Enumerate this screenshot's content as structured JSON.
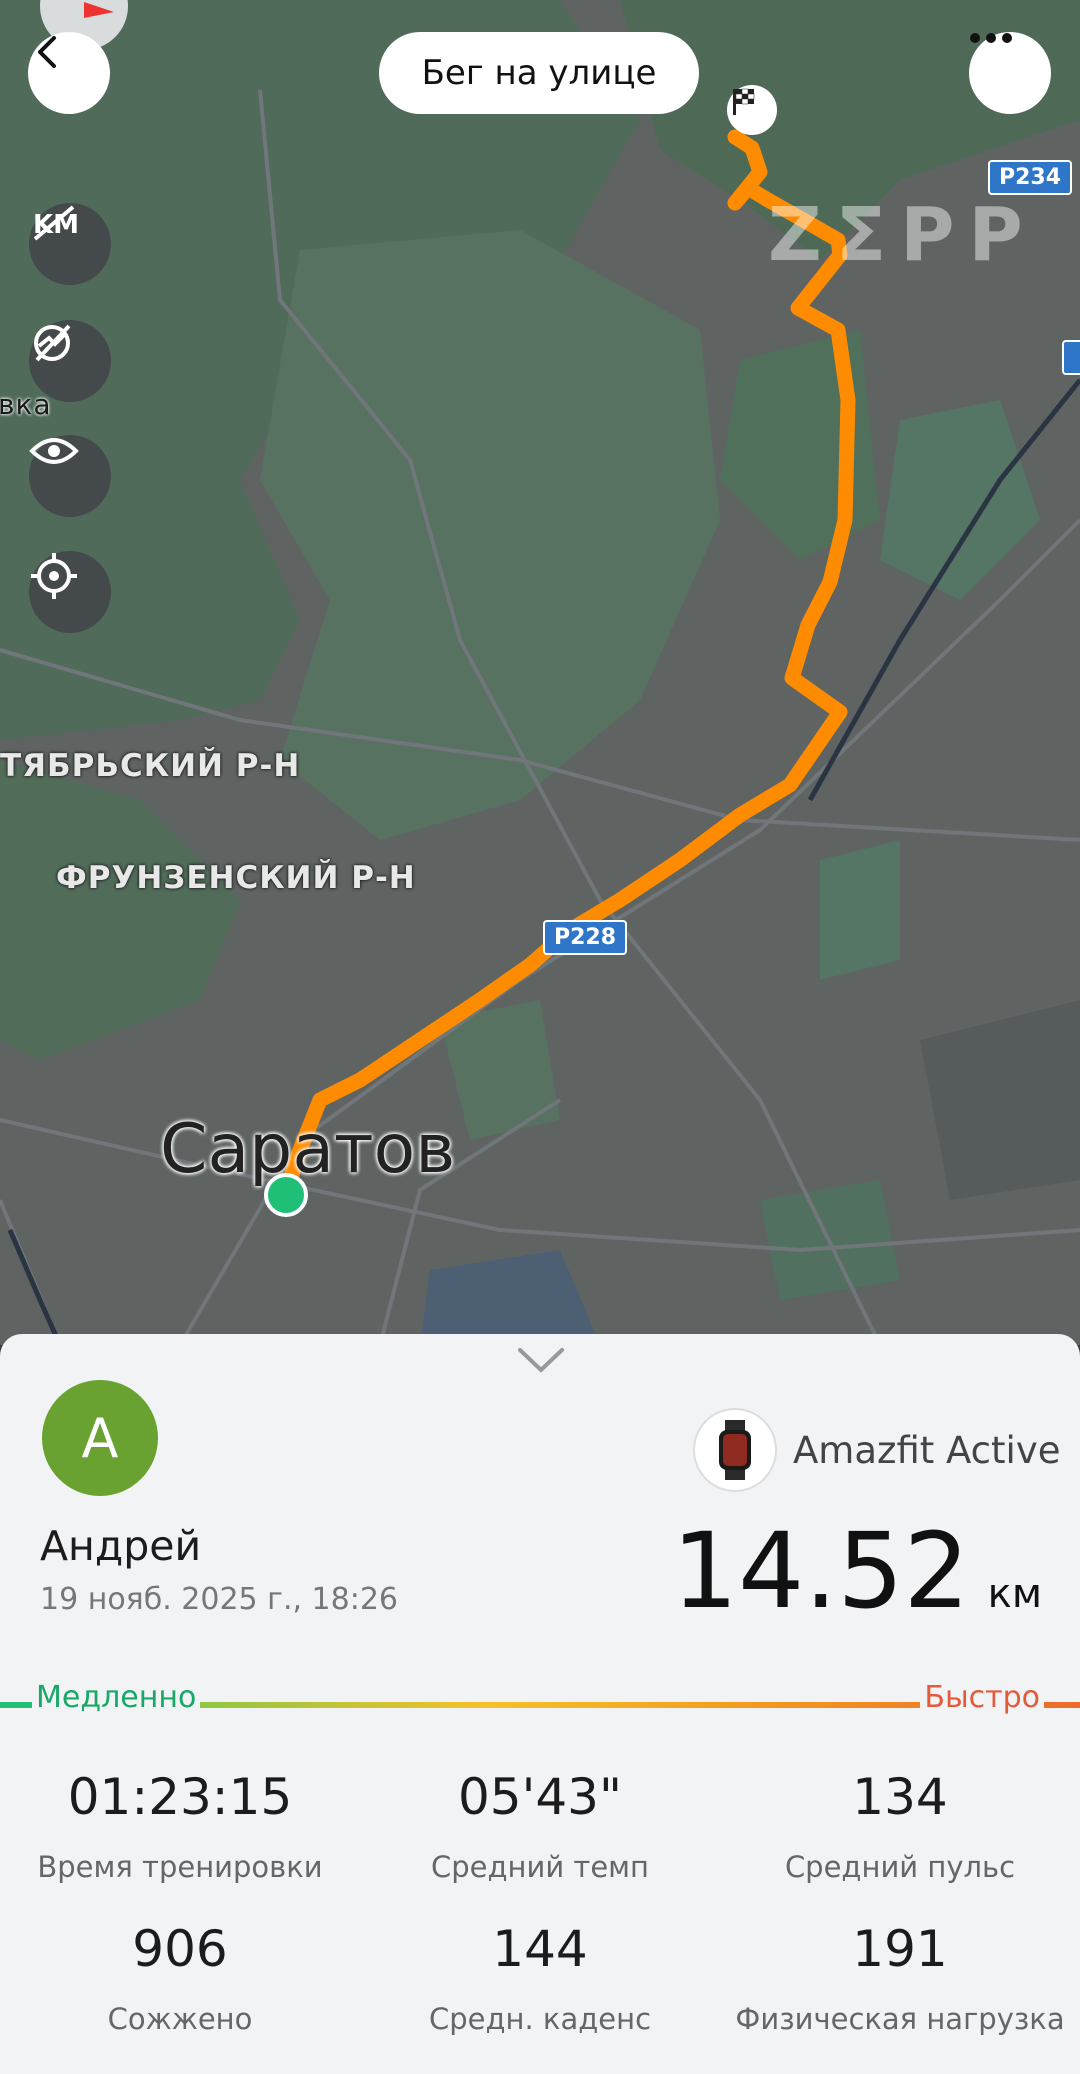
{
  "header": {
    "title": "Бег на улице",
    "back_icon": "chevron-left-icon",
    "more_icon": "more-dots-icon"
  },
  "map": {
    "city": "Саратов",
    "districts": [
      "ТЯБРЬСКИЙ Р-Н",
      "ФРУНЗЕНСКИЙ Р-Н"
    ],
    "partial_place": "вка",
    "roads": [
      "P234",
      "P228"
    ],
    "watermark": "ZΣPP",
    "tools": [
      "km-marker-icon",
      "no-pace-icon",
      "eye-icon",
      "locate-icon"
    ],
    "route_color": "#ff8c00"
  },
  "summary": {
    "avatar_letter": "A",
    "user_name": "Андрей",
    "datetime": "19 нояб. 2025 г., 18:26",
    "device": "Amazfit Active",
    "distance": "14.52",
    "distance_unit": "км",
    "pace_slow": "Медленно",
    "pace_fast": "Быстро",
    "stats": [
      {
        "value": "01:23:15",
        "label": "Время тренировки"
      },
      {
        "value": "05'43\"",
        "label": "Средний темп"
      },
      {
        "value": "134",
        "label": "Средний пульс"
      },
      {
        "value": "906",
        "label": "Сожжено"
      },
      {
        "value": "144",
        "label": "Средн. каденс"
      },
      {
        "value": "191",
        "label": "Физическая нагрузка"
      }
    ]
  }
}
